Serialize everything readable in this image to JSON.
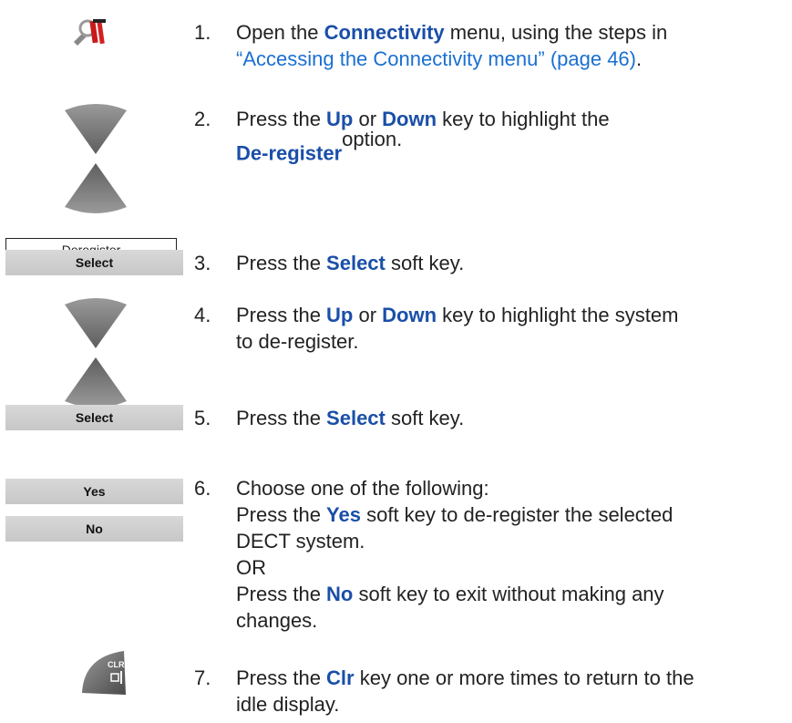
{
  "steps": [
    {
      "num": "1.",
      "a": "Open the ",
      "kw1": "Connectivity",
      "b": " menu, using the steps in",
      "link": "“Accessing the Connectivity menu” (page 46)",
      "c": "."
    },
    {
      "num": "2.",
      "a": "Press the ",
      "kw1": "Up",
      "b": " or ",
      "kw2": "Down",
      "c": " key to highlight the",
      "kw3": "De-register",
      "d": "option."
    },
    {
      "num": "3.",
      "a": "Press the ",
      "kw1": "Select",
      "b": " soft key."
    },
    {
      "num": "4.",
      "a": "Press the ",
      "kw1": "Up",
      "b": " or ",
      "kw2": "Down",
      "c": " key to highlight the system",
      "d": "to de-register."
    },
    {
      "num": "5.",
      "a": "Press the ",
      "kw1": "Select",
      "b": " soft key."
    },
    {
      "num": "6.",
      "line1": "Choose one of the following:",
      "a": "Press the ",
      "kw1": "Yes",
      "b": " soft key to de-register the selected",
      "c": "DECT system.",
      "or": "OR",
      "d": "Press the ",
      "kw2": "No",
      "e": " soft key to exit without making any",
      "f": "changes."
    },
    {
      "num": "7.",
      "a": "Press the ",
      "kw1": "Clr",
      "b": " key one or more times to return to the",
      "c": "idle display."
    }
  ],
  "softkeys": {
    "deregister": "Deregister",
    "select1": "Select",
    "select2": "Select",
    "yes": "Yes",
    "no": "No"
  },
  "icons": {
    "clr_top": "CLR",
    "menu_icon": "wrench-phone-icon"
  }
}
